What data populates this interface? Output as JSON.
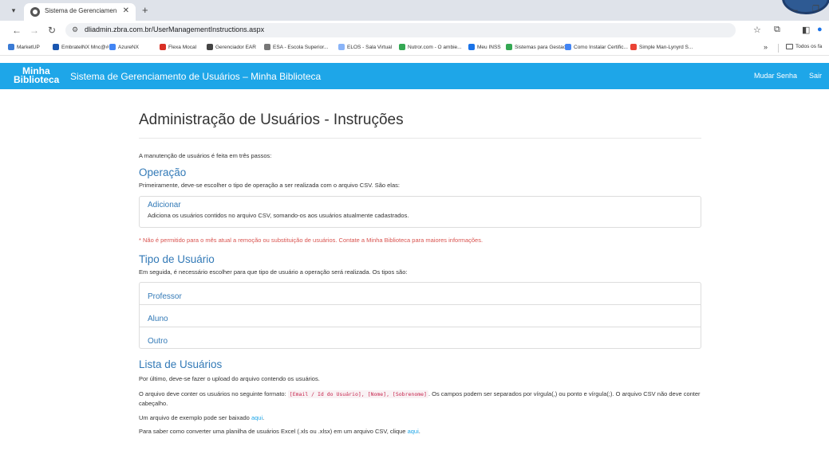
{
  "browser": {
    "tab_title": "Sistema de Gerenciamento de Usu",
    "url": "dliadmin.zbra.com.br/UserManagementInstructions.aspx",
    "bookmarks": [
      {
        "label": "MarketUP",
        "color": "#3a7bd5"
      },
      {
        "label": "EmbratelNX Mnc@#",
        "color": "#1a56b0"
      },
      {
        "label": "AzureNX",
        "color": "#4285f4"
      },
      {
        "label": "Flexa Mocal",
        "color": "#d93025"
      },
      {
        "label": "Gerenciador EAR",
        "color": "#444444"
      },
      {
        "label": "ESA - Escola Superior...",
        "color": "#777777"
      },
      {
        "label": "ELOS - Sala Virtual",
        "color": "#8ab4f8"
      },
      {
        "label": "Nutror.com - O ambie...",
        "color": "#34a853"
      },
      {
        "label": "Meu INSS",
        "color": "#1a73e8"
      },
      {
        "label": "Sistemas para Gestao...",
        "color": "#34a853"
      },
      {
        "label": "Como Instalar Certific...",
        "color": "#4285f4"
      },
      {
        "label": "Simple Man-Lynyrd S...",
        "color": "#ea4335"
      }
    ],
    "bookmarks_folder": "Todos os fa"
  },
  "header": {
    "logo_line1": "Minha",
    "logo_line2": "Biblioteca",
    "title": "Sistema de Gerenciamento de Usuários – Minha Biblioteca",
    "change_password": "Mudar Senha",
    "logout": "Sair"
  },
  "main": {
    "page_title": "Administração de Usuários - Instruções",
    "intro": "A manutenção de usuários é feita em três passos:",
    "operation": {
      "heading": "Operação",
      "description": "Primeiramente, deve-se escolher o tipo de operação a ser realizada com o arquivo CSV. São elas:",
      "item_title": "Adicionar",
      "item_text": "Adiciona os usuários contidos no arquivo CSV, somando-os aos usuários atualmente cadastrados.",
      "warning": "* Não é permitido para o mês atual a remoção ou substituição de usuários. Contate a Minha Biblioteca para maiores informações."
    },
    "user_type": {
      "heading": "Tipo de Usuário",
      "description": "Em seguida, é necessário escolher para que tipo de usuário a operação será realizada. Os tipos são:",
      "items": [
        "Professor",
        "Aluno",
        "Outro"
      ]
    },
    "user_list": {
      "heading": "Lista de Usuários",
      "p1": "Por último, deve-se fazer o upload do arquivo contendo os usuários.",
      "p2_before": "O arquivo deve conter os usuários no seguinte formato:",
      "p2_code": "[Email / Id do Usuário], [Nome], [Sobrenome]",
      "p2_after": ". Os campos podem ser separados por vírgula(,) ou ponto e vírgula(;). O arquivo CSV não deve conter cabeçalho.",
      "p3_before": "Um arquivo de exemplo pode ser baixado",
      "p3_link": "aqui",
      "p3_after": ".",
      "p4_before": "Para saber como converter uma planilha de usuários Excel (.xls ou .xlsx) em um arquivo CSV, clique",
      "p4_link": "aqui",
      "p4_after": "."
    }
  }
}
